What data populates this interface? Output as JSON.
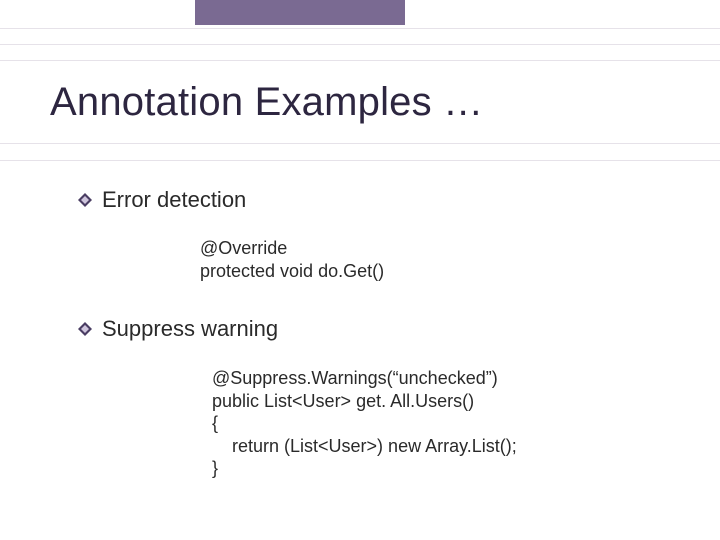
{
  "title": "Annotation Examples …",
  "sections": [
    {
      "label": "Error detection",
      "code": "@Override\nprotected void do.Get()"
    },
    {
      "label": "Suppress warning",
      "code": "@Suppress.Warnings(“unchecked”)\npublic List<User> get. All.Users()\n{\n    return (List<User>) new Array.List();\n}"
    }
  ]
}
